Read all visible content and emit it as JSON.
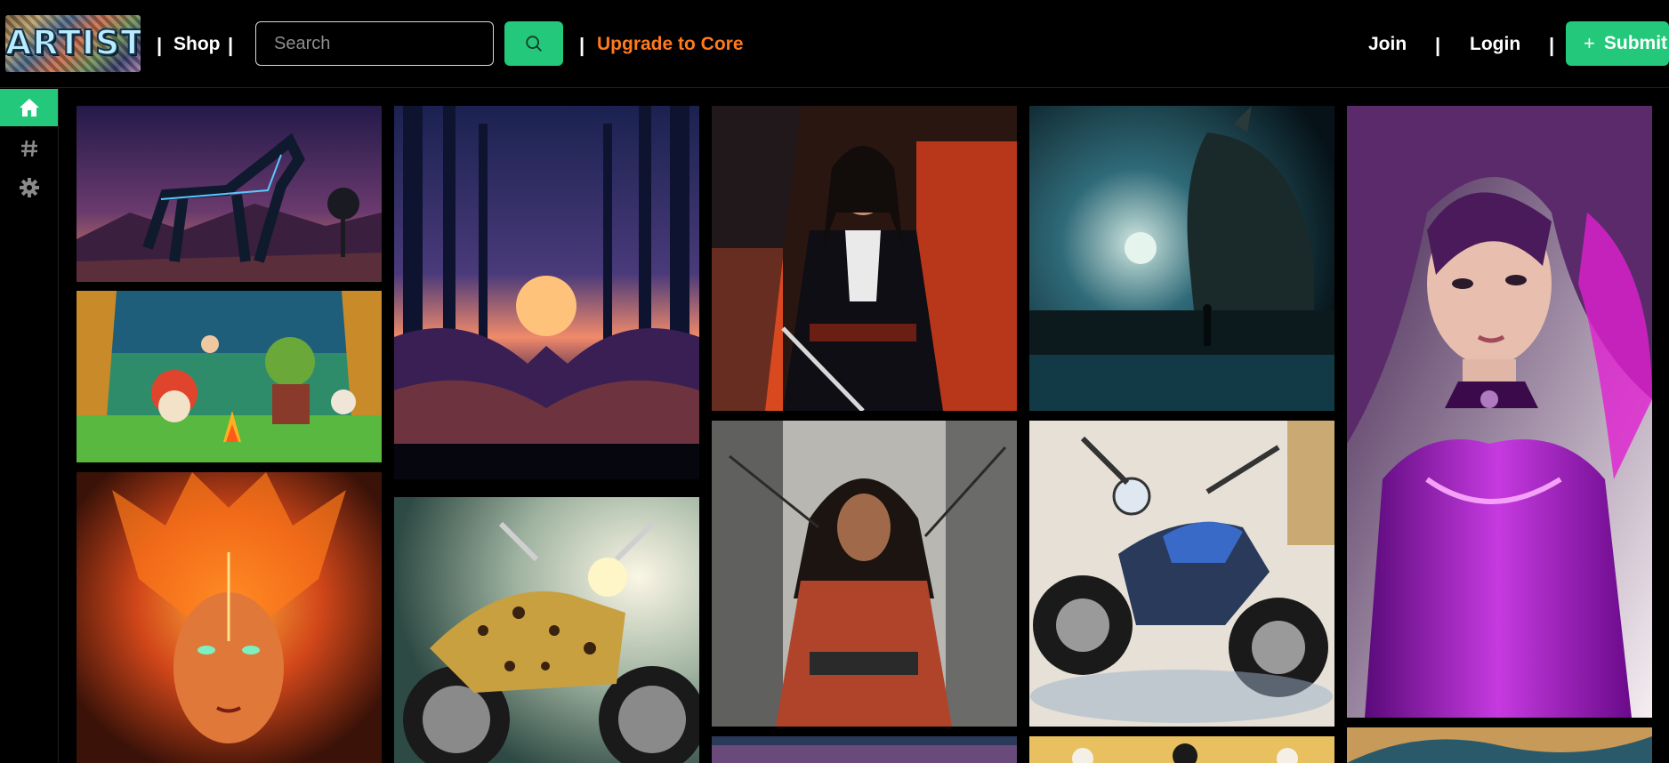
{
  "header": {
    "logo_text": "ARTIST",
    "shop_label": "Shop",
    "separator": "|",
    "search_placeholder": "Search",
    "upgrade_label": "Upgrade to Core",
    "join_label": "Join",
    "login_label": "Login",
    "submit_label": "Submit"
  },
  "sidebar": {
    "items": [
      {
        "icon": "home-icon",
        "active": true
      },
      {
        "icon": "hash-icon",
        "active": false
      },
      {
        "icon": "gear-icon",
        "active": false
      }
    ]
  },
  "colors": {
    "accent": "#23c87a",
    "upgrade": "#ff7a1a",
    "background": "#000000"
  },
  "gallery": {
    "tiles": [
      "tile-blue-horse",
      "tile-gnome-campfire",
      "tile-fire-woman",
      "tile-purple-forest-sunset",
      "tile-leopard-motorcycle",
      "tile-samurai-woman-red",
      "tile-warrior-woman-sketch",
      "tile-dark-knight-lake",
      "tile-blue-motorcycle",
      "tile-purple-hair-woman"
    ]
  }
}
